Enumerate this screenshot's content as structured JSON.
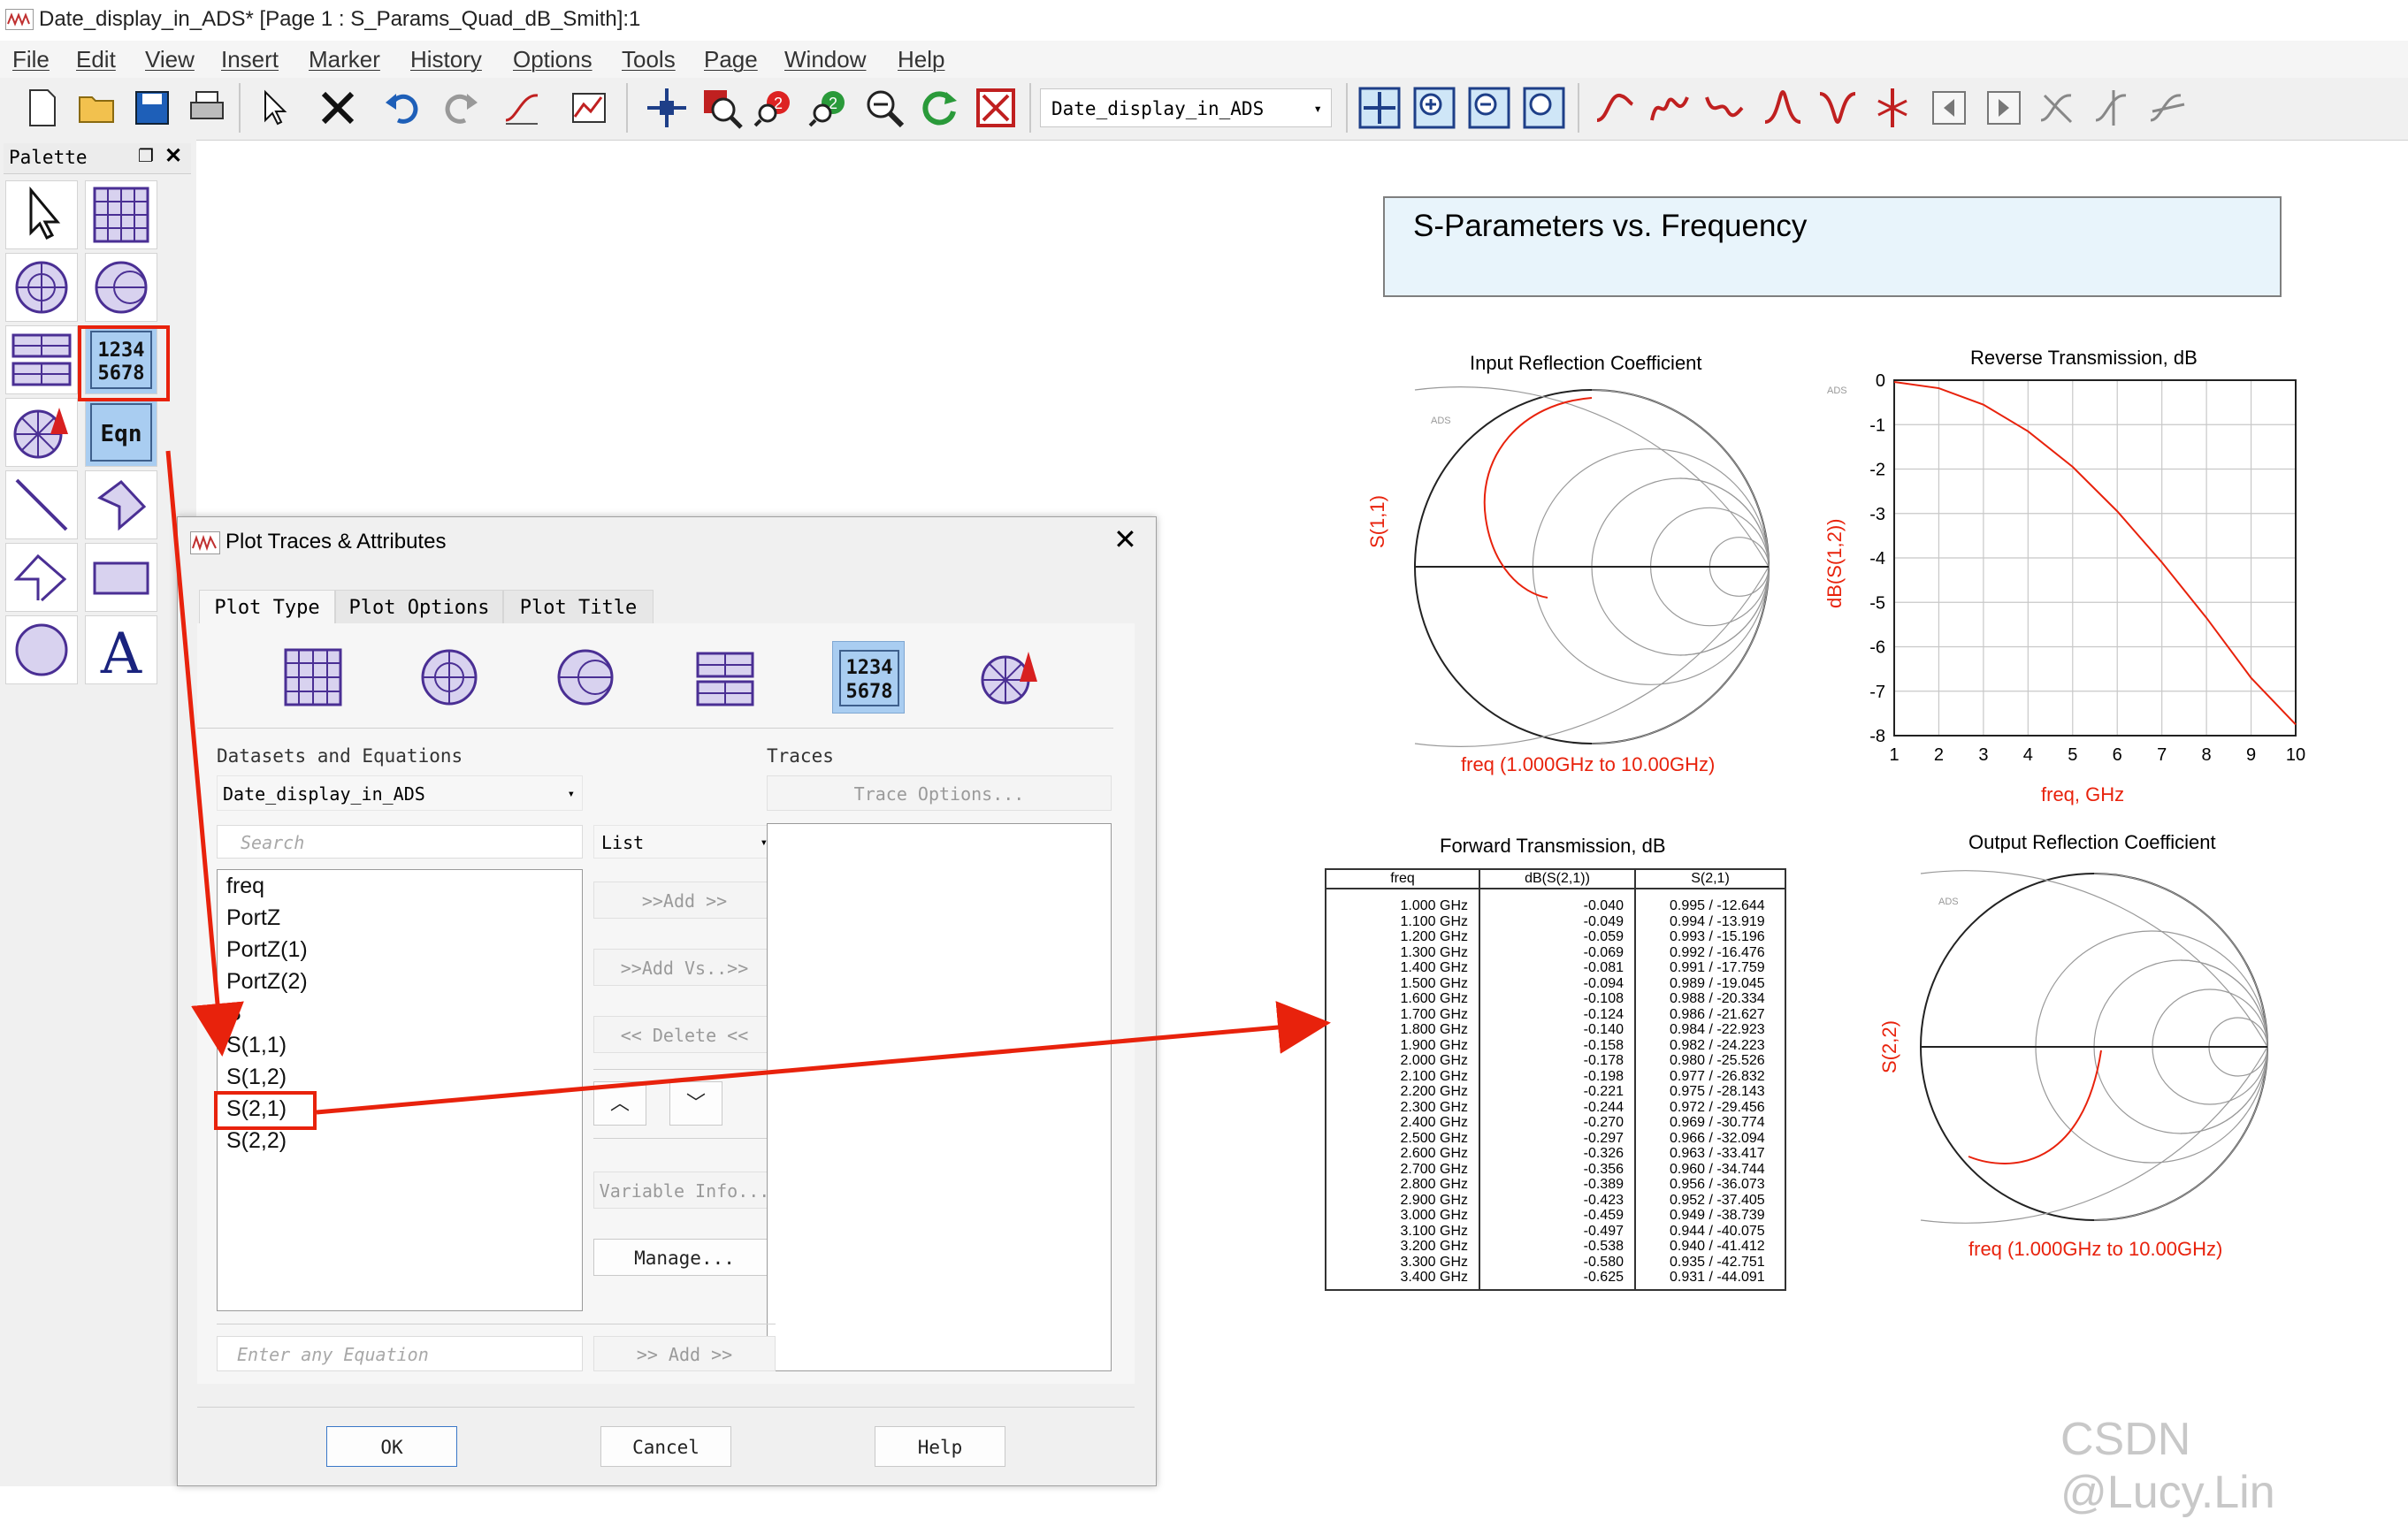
{
  "window": {
    "title": "Date_display_in_ADS* [Page 1 : S_Params_Quad_dB_Smith]:1",
    "icon": "ads-window-icon"
  },
  "menu": [
    "File",
    "Edit",
    "View",
    "Insert",
    "Marker",
    "History",
    "Options",
    "Tools",
    "Page",
    "Window",
    "Help"
  ],
  "toolbar": {
    "dataset_combo": "Date_display_in_ADS",
    "icons": [
      "new-page-icon",
      "open-folder-icon",
      "save-icon",
      "print-icon",
      "select-arrow-icon",
      "delete-x-icon",
      "undo-icon",
      "redo-icon",
      "insert-trace-icon",
      "plot-icon",
      "move-icon",
      "zoom-area-icon",
      "zoom-in-icon",
      "zoom-out-icon",
      "zoom-icon",
      "refresh-icon",
      "stop-icon"
    ]
  },
  "palette": {
    "title": "Palette",
    "items": [
      "select-arrow-icon",
      "rectangular-plot-icon",
      "polar-plot-icon",
      "smith-chart-icon",
      "stacked-plot-icon",
      "list-table-icon",
      "antenna-plot-icon",
      "equation-icon",
      "line-icon",
      "polygon-icon",
      "polyline-icon",
      "rectangle-icon",
      "circle-icon",
      "text-icon"
    ],
    "eqn_label": "Eqn",
    "list_label_top": "1234",
    "list_label_bottom": "5678",
    "text_label": "A"
  },
  "page": {
    "header": "S-Parameters vs. Frequency",
    "plot1": {
      "title": "Input Reflection Coefficient",
      "ylabel": "S(1,1)",
      "caption": "freq (1.000GHz to 10.00GHz)"
    },
    "plot2": {
      "title": "Reverse Transmission, dB",
      "ylabel": "dB(S(1,2))",
      "xlabel": "freq, GHz"
    },
    "plot3": {
      "title": "Forward Transmission, dB"
    },
    "plot4": {
      "title": "Output Reflection Coefficient",
      "ylabel": "S(2,2)",
      "caption": "freq (1.000GHz to 10.00GHz)"
    },
    "ads_tag": "ADS"
  },
  "chart_data": [
    {
      "type": "line",
      "title": "Reverse Transmission, dB",
      "xlabel": "freq, GHz",
      "ylabel": "dB(S(1,2))",
      "xlim": [
        1,
        10
      ],
      "ylim": [
        -8,
        0
      ],
      "xticks": [
        "1",
        "2",
        "3",
        "4",
        "5",
        "6",
        "7",
        "8",
        "9",
        "10"
      ],
      "yticks": [
        "0",
        "-1",
        "-2",
        "-3",
        "-4",
        "-5",
        "-6",
        "-7",
        "-8"
      ],
      "series": [
        {
          "x": [
            1,
            2,
            3,
            4,
            5,
            6,
            7,
            8,
            9,
            10
          ],
          "y": [
            -0.04,
            -0.18,
            -0.55,
            -1.15,
            -1.95,
            -2.95,
            -4.1,
            -5.35,
            -6.7,
            -7.75
          ]
        }
      ]
    },
    {
      "type": "table",
      "title": "Forward Transmission, dB",
      "columns": [
        "freq",
        "dB(S(2,1))",
        "S(2,1)"
      ],
      "rows": [
        [
          "1.000 GHz",
          "-0.040",
          "0.995 / -12.644"
        ],
        [
          "1.100 GHz",
          "-0.049",
          "0.994 / -13.919"
        ],
        [
          "1.200 GHz",
          "-0.059",
          "0.993 / -15.196"
        ],
        [
          "1.300 GHz",
          "-0.069",
          "0.992 / -16.476"
        ],
        [
          "1.400 GHz",
          "-0.081",
          "0.991 / -17.759"
        ],
        [
          "1.500 GHz",
          "-0.094",
          "0.989 / -19.045"
        ],
        [
          "1.600 GHz",
          "-0.108",
          "0.988 / -20.334"
        ],
        [
          "1.700 GHz",
          "-0.124",
          "0.986 / -21.627"
        ],
        [
          "1.800 GHz",
          "-0.140",
          "0.984 / -22.923"
        ],
        [
          "1.900 GHz",
          "-0.158",
          "0.982 / -24.223"
        ],
        [
          "2.000 GHz",
          "-0.178",
          "0.980 / -25.526"
        ],
        [
          "2.100 GHz",
          "-0.198",
          "0.977 / -26.832"
        ],
        [
          "2.200 GHz",
          "-0.221",
          "0.975 / -28.143"
        ],
        [
          "2.300 GHz",
          "-0.244",
          "0.972 / -29.456"
        ],
        [
          "2.400 GHz",
          "-0.270",
          "0.969 / -30.774"
        ],
        [
          "2.500 GHz",
          "-0.297",
          "0.966 / -32.094"
        ],
        [
          "2.600 GHz",
          "-0.326",
          "0.963 / -33.417"
        ],
        [
          "2.700 GHz",
          "-0.356",
          "0.960 / -34.744"
        ],
        [
          "2.800 GHz",
          "-0.389",
          "0.956 / -36.073"
        ],
        [
          "2.900 GHz",
          "-0.423",
          "0.952 / -37.405"
        ],
        [
          "3.000 GHz",
          "-0.459",
          "0.949 / -38.739"
        ],
        [
          "3.100 GHz",
          "-0.497",
          "0.944 / -40.075"
        ],
        [
          "3.200 GHz",
          "-0.538",
          "0.940 / -41.412"
        ],
        [
          "3.300 GHz",
          "-0.580",
          "0.935 / -42.751"
        ],
        [
          "3.400 GHz",
          "-0.625",
          "0.931 / -44.091"
        ]
      ]
    }
  ],
  "dialog": {
    "title": "Plot Traces & Attributes",
    "tabs": [
      "Plot Type",
      "Plot Options",
      "Plot Title"
    ],
    "datasets_label": "Datasets and Equations",
    "traces_label": "Traces",
    "dataset_value": "Date_display_in_ADS",
    "search_placeholder": "Search",
    "list_mode": "List",
    "trace_options": "Trace Options...",
    "variables": [
      "freq",
      "PortZ",
      "PortZ(1)",
      "PortZ(2)",
      "S",
      "S(1,1)",
      "S(1,2)",
      "S(2,1)",
      "S(2,2)"
    ],
    "add": ">>Add >>",
    "add_vs": ">>Add Vs..>>",
    "delete": "<< Delete <<",
    "variable_info": "Variable Info...",
    "manage": "Manage...",
    "equation_placeholder": "Enter any Equation",
    "add2": ">> Add >>",
    "ok": "OK",
    "cancel": "Cancel",
    "help": "Help",
    "list_top": "1234",
    "list_bottom": "5678"
  },
  "watermark": "CSDN @Lucy.Lin",
  "colors": {
    "trace": "#e8220c",
    "highlight_box": "#e8220c",
    "palette_icon": "#5a3fa0",
    "header_fill": "#e8f4fb"
  }
}
